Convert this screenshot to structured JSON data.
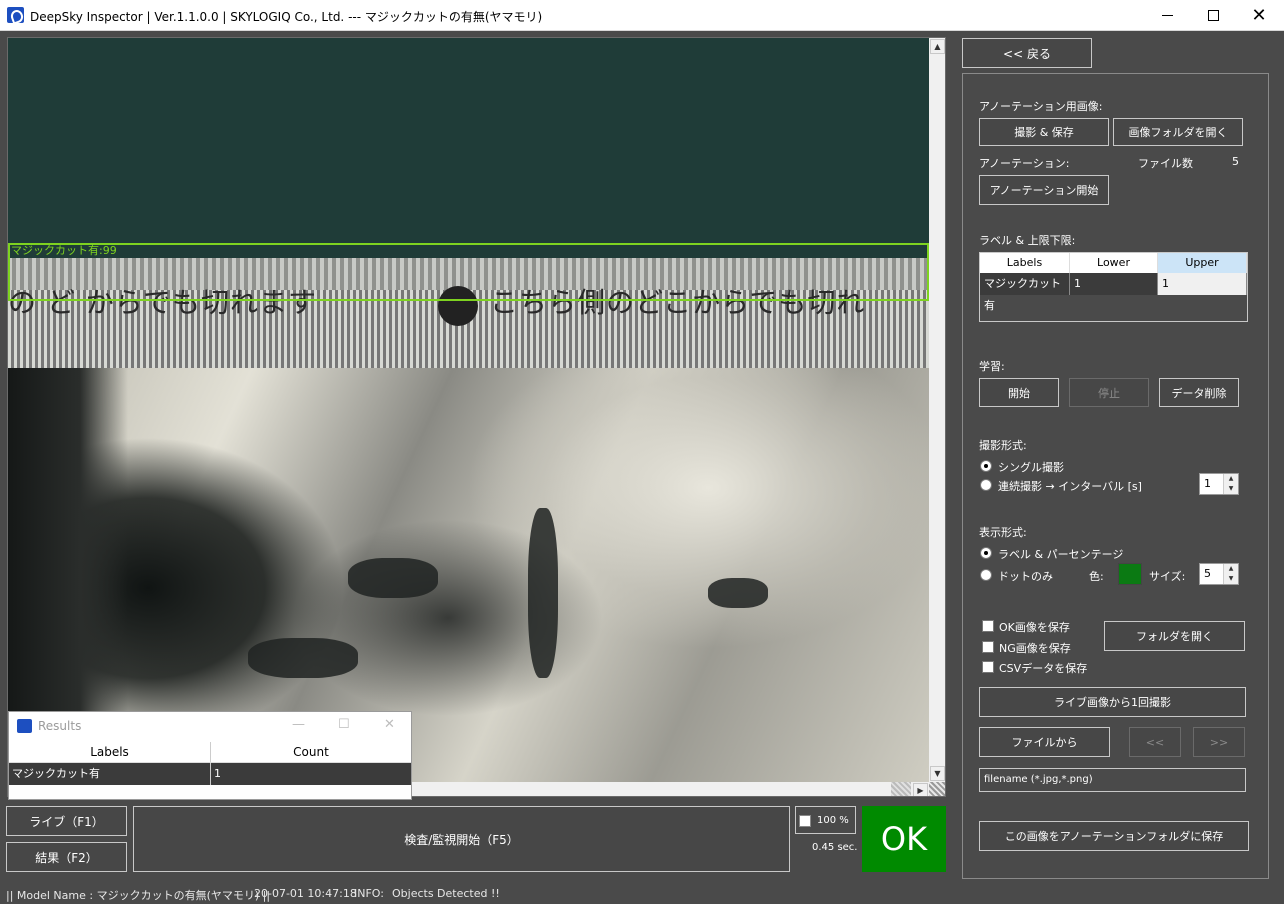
{
  "window": {
    "title": "DeepSky Inspector | Ver.1.1.0.0 | SKYLOGIQ Co., Ltd. --- マジックカットの有無(ヤマモリ)",
    "close_glyph": "✕"
  },
  "viewer": {
    "detection_label": "マジックカット有:99",
    "printed_text_left": "の ど からでも切れます",
    "printed_text_right": "こちら側のどこからでも切れ",
    "scroll_up": "▲",
    "scroll_down": "▼",
    "scroll_right": "▶"
  },
  "results_window": {
    "title": "Results",
    "minimize": "—",
    "maximize": "☐",
    "close": "✕",
    "headers": [
      "Labels",
      "Count"
    ],
    "rows": [
      {
        "label": "マジックカット有",
        "count": "1"
      }
    ]
  },
  "controls": {
    "live_button": "ライブ（F1）",
    "result_button": "結果（F2）",
    "inspect_button": "検査/監視開始（F5）",
    "zoom_percent": "100 %",
    "elapsed": "0.45 sec.",
    "judgement": "OK",
    "judgement_color": "#008a00"
  },
  "status": {
    "model": "|| Model Name : マジックカットの有無(ヤマモリ) ||",
    "timestamp": "20-07-01 10:47:18",
    "info_label": "INFO:",
    "info_message": "Objects Detected !!"
  },
  "panel": {
    "back_button": "<< 戻る",
    "annotation_images_label": "アノーテーション用画像:",
    "capture_save_button": "撮影 & 保存",
    "open_image_folder_button": "画像フォルダを開く",
    "annotation_label": "アノーテーション:",
    "file_count_label": "ファイル数",
    "file_count": "5",
    "annotation_start_button": "アノーテーション開始",
    "label_limits_label": "ラベル & 上限下限:",
    "label_table": {
      "headers": [
        "Labels",
        "Lower",
        "Upper"
      ],
      "rows": [
        {
          "label": "マジックカット有",
          "lower": "1",
          "upper": "1"
        }
      ]
    },
    "training_label": "学習:",
    "train_start_button": "開始",
    "train_stop_button": "停止",
    "delete_data_button": "データ削除",
    "capture_mode_label": "撮影形式:",
    "single_capture": "シングル撮影",
    "continuous_capture": "連続撮影 → インターバル [s]",
    "interval_value": "1",
    "display_mode_label": "表示形式:",
    "label_percent_option": "ラベル & パーセンテージ",
    "dots_only_option": "ドットのみ",
    "color_label": "色:",
    "dot_color": "#0b7a13",
    "size_label": "サイズ:",
    "size_value": "5",
    "save_ok_images": "OK画像を保存",
    "save_ng_images": "NG画像を保存",
    "save_csv": "CSVデータを保存",
    "open_folder_button": "フォルダを開く",
    "capture_from_live_button": "ライブ画像から1回撮影",
    "from_file_button": "ファイルから",
    "prev_button": "<<",
    "next_button": ">>",
    "filename_placeholder": "filename (*.jpg,*.png)",
    "save_to_annotation_button": "この画像をアノーテーションフォルダに保存"
  }
}
